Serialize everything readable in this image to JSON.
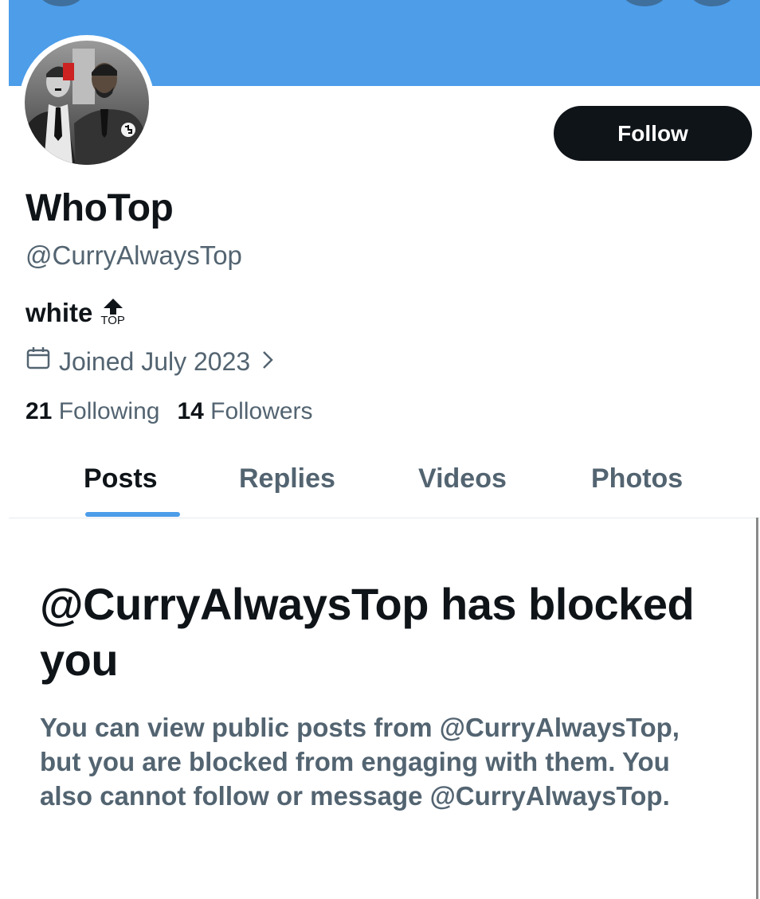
{
  "profile": {
    "display_name": "WhoTop",
    "handle": "@CurryAlwaysTop",
    "bio_text": "white",
    "bio_emoji_text": "TOP",
    "joined_text": "Joined July 2023",
    "following_count": "21",
    "following_label": "Following",
    "followers_count": "14",
    "followers_label": "Followers"
  },
  "actions": {
    "follow_label": "Follow"
  },
  "tabs": [
    {
      "label": "Posts",
      "active": true
    },
    {
      "label": "Replies",
      "active": false
    },
    {
      "label": "Videos",
      "active": false
    },
    {
      "label": "Photos",
      "active": false
    }
  ],
  "blocked": {
    "title": "@CurryAlwaysTop has blocked you",
    "message": "You can view public posts from @CurryAlwaysTop, but you are blocked from engaging with them. You also cannot follow or message @CurryAlwaysTop."
  },
  "colors": {
    "banner": "#4d9de9",
    "follow_button": "#0f1419",
    "secondary_text": "#536471",
    "tab_indicator": "#4d9de9"
  },
  "icons": [
    "calendar-icon",
    "chevron-right-icon",
    "top-arrow-emoji"
  ]
}
